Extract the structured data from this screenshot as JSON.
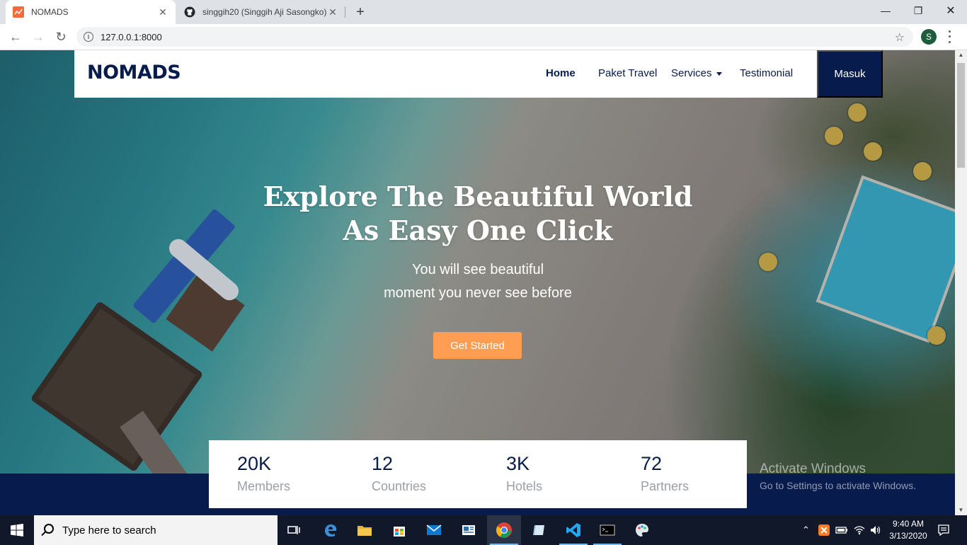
{
  "browser": {
    "tabs": [
      {
        "title": "NOMADS",
        "active": true
      },
      {
        "title": "singgih20 (Singgih Aji Sasongko)",
        "active": false
      }
    ],
    "url": "127.0.0.1:8000",
    "profile_initial": "S"
  },
  "site": {
    "logo": "NOMADS",
    "nav": {
      "home": "Home",
      "paket_travel": "Paket Travel",
      "services": "Services",
      "testimonial": "Testimonial",
      "login": "Masuk"
    },
    "hero": {
      "title_line1": "Explore The Beautiful World",
      "title_line2": "As Easy One Click",
      "subtitle_line1": "You will see beautiful",
      "subtitle_line2": "moment you never see before",
      "cta": "Get Started"
    },
    "stats": [
      {
        "value": "20K",
        "label": "Members"
      },
      {
        "value": "12",
        "label": "Countries"
      },
      {
        "value": "3K",
        "label": "Hotels"
      },
      {
        "value": "72",
        "label": "Partners"
      }
    ]
  },
  "watermark": {
    "line1": "Activate Windows",
    "line2": "Go to Settings to activate Windows."
  },
  "taskbar": {
    "search_placeholder": "Type here to search",
    "time": "9:40 AM",
    "date": "3/13/2020",
    "accent": "#76b9ed"
  },
  "colors": {
    "brand_navy": "#071c4d",
    "cta_orange": "#ff9e53"
  }
}
